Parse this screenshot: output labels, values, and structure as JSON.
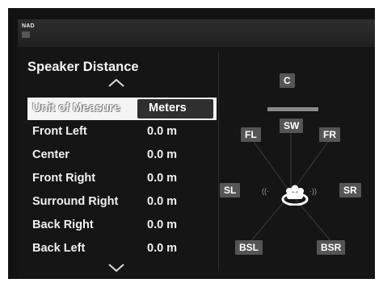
{
  "brand": "NAD",
  "page_title": "Speaker Distance",
  "unit_setting": {
    "label": "Unit of Measure",
    "value": "Meters"
  },
  "rows": [
    {
      "label": "Front Left",
      "value": "0.0 m"
    },
    {
      "label": "Center",
      "value": "0.0 m"
    },
    {
      "label": "Front Right",
      "value": "0.0 m"
    },
    {
      "label": "Surround Right",
      "value": "0.0 m"
    },
    {
      "label": "Back Right",
      "value": "0.0 m"
    },
    {
      "label": "Back Left",
      "value": "0.0 m"
    }
  ],
  "speakers": {
    "center": "C",
    "subwoofer": "SW",
    "front_left": "FL",
    "front_right": "FR",
    "surround_left": "SL",
    "surround_right": "SR",
    "back_left": "BSL",
    "back_right": "BSR"
  },
  "icons": [
    "scroll-up-icon",
    "scroll-down-icon",
    "listener-icon",
    "sound-wave-icon"
  ],
  "colors": {
    "background": "#151515",
    "speaker_box": "#555555",
    "highlight": "#f4f4f4"
  }
}
